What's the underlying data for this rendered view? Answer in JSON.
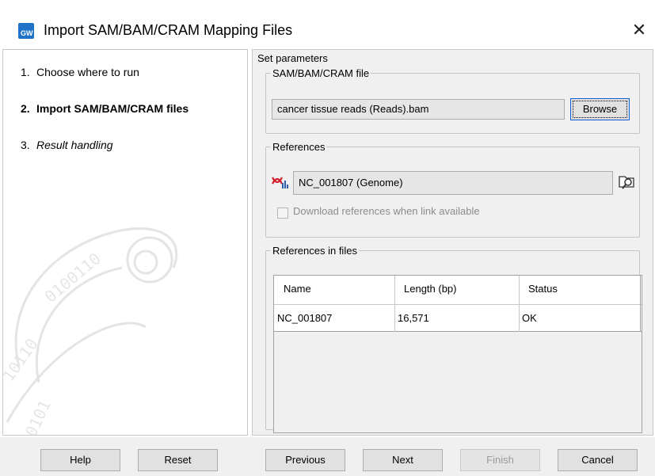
{
  "window": {
    "title": "Import SAM/BAM/CRAM Mapping Files",
    "icon_text": "GW",
    "close_glyph": "✕"
  },
  "steps": [
    {
      "num": "1.",
      "label": "Choose where to run",
      "style": "normal"
    },
    {
      "num": "2.",
      "label": "Import SAM/BAM/CRAM files",
      "style": "bold"
    },
    {
      "num": "3.",
      "label": "Result handling",
      "style": "italic"
    }
  ],
  "params": {
    "heading": "Set parameters",
    "file_group": {
      "legend": "SAM/BAM/CRAM file",
      "value": "cancer tissue reads (Reads).bam",
      "browse_label": "Browse"
    },
    "references_group": {
      "legend": "References",
      "value": "NC_001807 (Genome)",
      "download_label": "Download references when link available",
      "download_checked": false
    },
    "references_in_files": {
      "legend": "References in files",
      "columns": [
        "Name",
        "Length (bp)",
        "Status"
      ],
      "rows": [
        {
          "name": "NC_001807",
          "length": "16,571",
          "status": "OK"
        }
      ]
    }
  },
  "footer": {
    "help": "Help",
    "reset": "Reset",
    "previous": "Previous",
    "next": "Next",
    "finish": "Finish",
    "cancel": "Cancel"
  },
  "colors": {
    "accent": "#1e73c8",
    "panel_bg": "#f0f0f0",
    "button_bg": "#e1e1e1"
  }
}
